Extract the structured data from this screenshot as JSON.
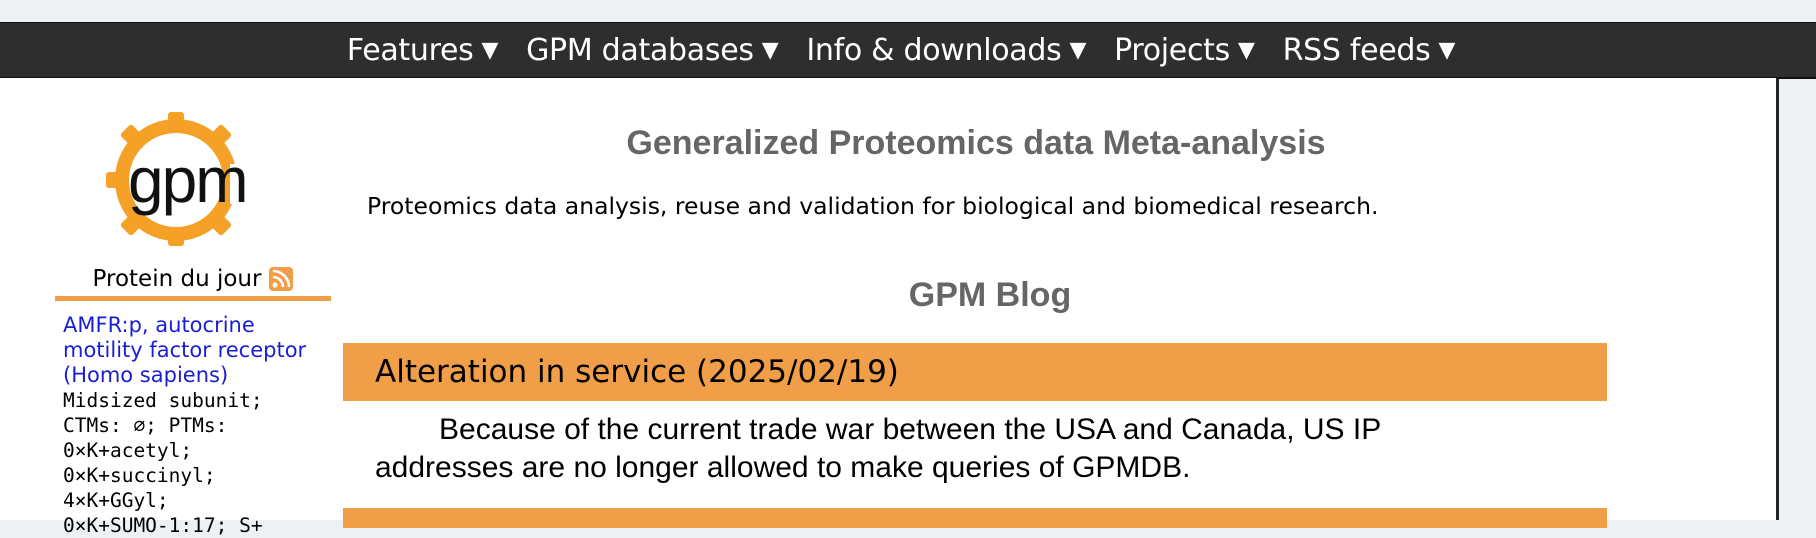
{
  "nav": {
    "items": [
      {
        "label": "Features",
        "arrow": "▼"
      },
      {
        "label": "GPM databases",
        "arrow": "▼"
      },
      {
        "label": "Info & downloads",
        "arrow": "▼"
      },
      {
        "label": "Projects",
        "arrow": "▼"
      },
      {
        "label": "RSS feeds",
        "arrow": "▼"
      }
    ]
  },
  "logo": {
    "text": "gpm",
    "color": "#f5a026"
  },
  "header": {
    "title": "Generalized Proteomics data Meta-analysis",
    "tagline": "Proteomics data analysis, reuse and validation for biological and biomedical research."
  },
  "sidebar": {
    "title": "Protein du jour",
    "link_lines": [
      "AMFR:p, autocrine",
      "motility factor receptor",
      "(Homo sapiens)"
    ],
    "detail_lines": [
      "Midsized subunit;",
      "CTMs: ∅; PTMs:",
      "0×K+acetyl;",
      "0×K+succinyl;",
      "4×K+GGyl;",
      "0×K+SUMO-1:17; S+"
    ]
  },
  "blog": {
    "heading": "GPM Blog",
    "posts": [
      {
        "title": "Alteration in service (2025/02/19)",
        "body_line1": "Because of the current trade war between the USA and Canada, US IP",
        "body_line2": "addresses are no longer allowed to make queries of GPMDB."
      }
    ]
  },
  "colors": {
    "accent": "#f09e48",
    "nav_bg": "#2e2e2e",
    "link": "#1a1ed2",
    "heading_gray": "#666666"
  }
}
